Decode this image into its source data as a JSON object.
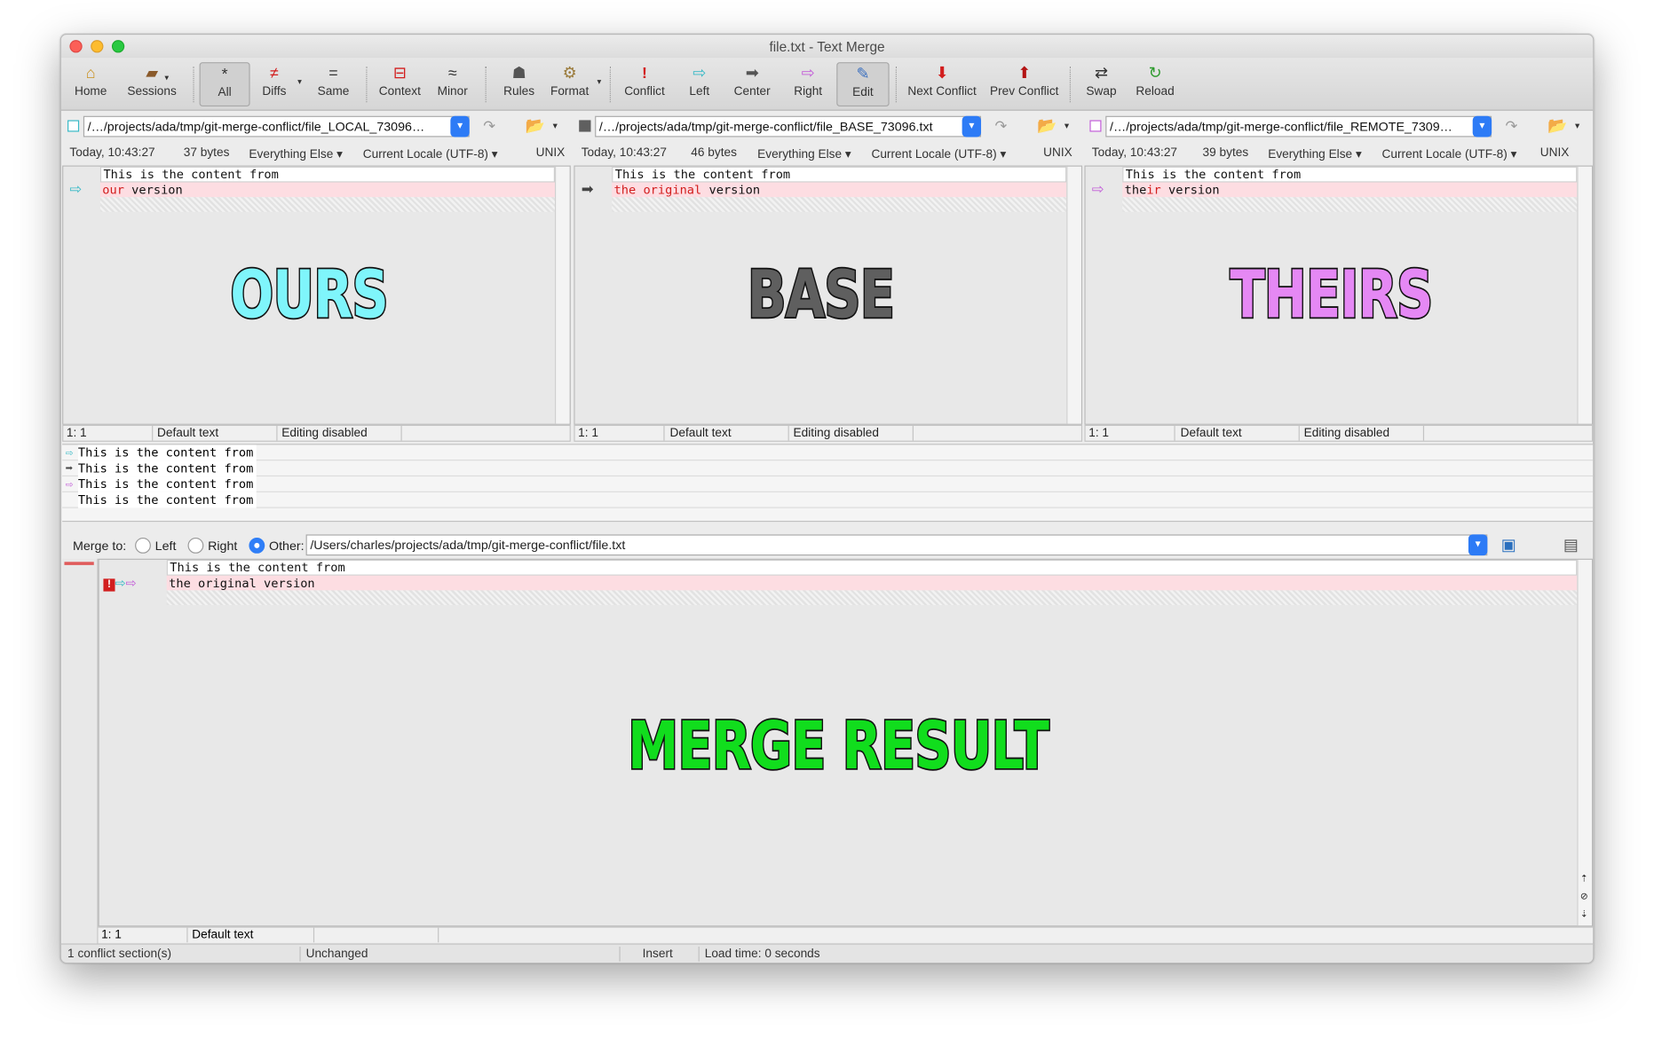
{
  "window": {
    "title": "file.txt - Text Merge"
  },
  "toolbar": {
    "home": "Home",
    "sessions": "Sessions",
    "all": "All",
    "diffs": "Diffs",
    "same": "Same",
    "context": "Context",
    "minor": "Minor",
    "rules": "Rules",
    "format": "Format",
    "conflict": "Conflict",
    "left": "Left",
    "center": "Center",
    "right": "Right",
    "edit": "Edit",
    "next_conflict": "Next Conflict",
    "prev_conflict": "Prev Conflict",
    "swap": "Swap",
    "reload": "Reload"
  },
  "panes": {
    "left": {
      "path": "/…/projects/ada/tmp/git-merge-conflict/file_LOCAL_73096…",
      "time": "Today, 10:43:27",
      "size": "37 bytes",
      "format": "Everything Else",
      "encoding": "Current Locale (UTF-8)",
      "lineending": "UNIX",
      "line1": "This is the content from",
      "line2_a": "our",
      "line2_b": " version",
      "label": "OURS",
      "label_color": "#7ff5fb",
      "status_pos": "1: 1",
      "status_text": "Default text",
      "status_edit": "Editing disabled"
    },
    "center": {
      "path": "/…/projects/ada/tmp/git-merge-conflict/file_BASE_73096.txt",
      "time": "Today, 10:43:27",
      "size": "46 bytes",
      "format": "Everything Else",
      "encoding": "Current Locale (UTF-8)",
      "lineending": "UNIX",
      "line1": "This is the content from",
      "line2_a": "the original",
      "line2_b": " version",
      "label": "BASE",
      "label_color": "#5f5f5f",
      "status_pos": "1: 1",
      "status_text": "Default text",
      "status_edit": "Editing disabled"
    },
    "right": {
      "path": "/…/projects/ada/tmp/git-merge-conflict/file_REMOTE_7309…",
      "time": "Today, 10:43:27",
      "size": "39 bytes",
      "format": "Everything Else",
      "encoding": "Current Locale (UTF-8)",
      "lineending": "UNIX",
      "line1": "This is the content from",
      "line2_a": "the",
      "line2_b": "ir",
      "line2_c": " version",
      "label": "THEIRS",
      "label_color": "#e588f4",
      "status_pos": "1: 1",
      "status_text": "Default text",
      "status_edit": "Editing disabled"
    }
  },
  "summary": [
    "This is the content from",
    "This is the content from",
    "This is the content from",
    "This is the content from"
  ],
  "merge": {
    "label": "Merge to:",
    "left": "Left",
    "right": "Right",
    "other": "Other:",
    "path": "/Users/charles/projects/ada/tmp/git-merge-conflict/file.txt",
    "line1": "This is the content from",
    "line2": "the original version",
    "label_big": "MERGE RESULT",
    "label_color": "#11dd1d",
    "status_pos": "1: 1",
    "status_text": "Default text"
  },
  "footer": {
    "conflicts": "1 conflict section(s)",
    "state": "Unchanged",
    "mode": "Insert",
    "loadtime": "Load time: 0 seconds"
  }
}
